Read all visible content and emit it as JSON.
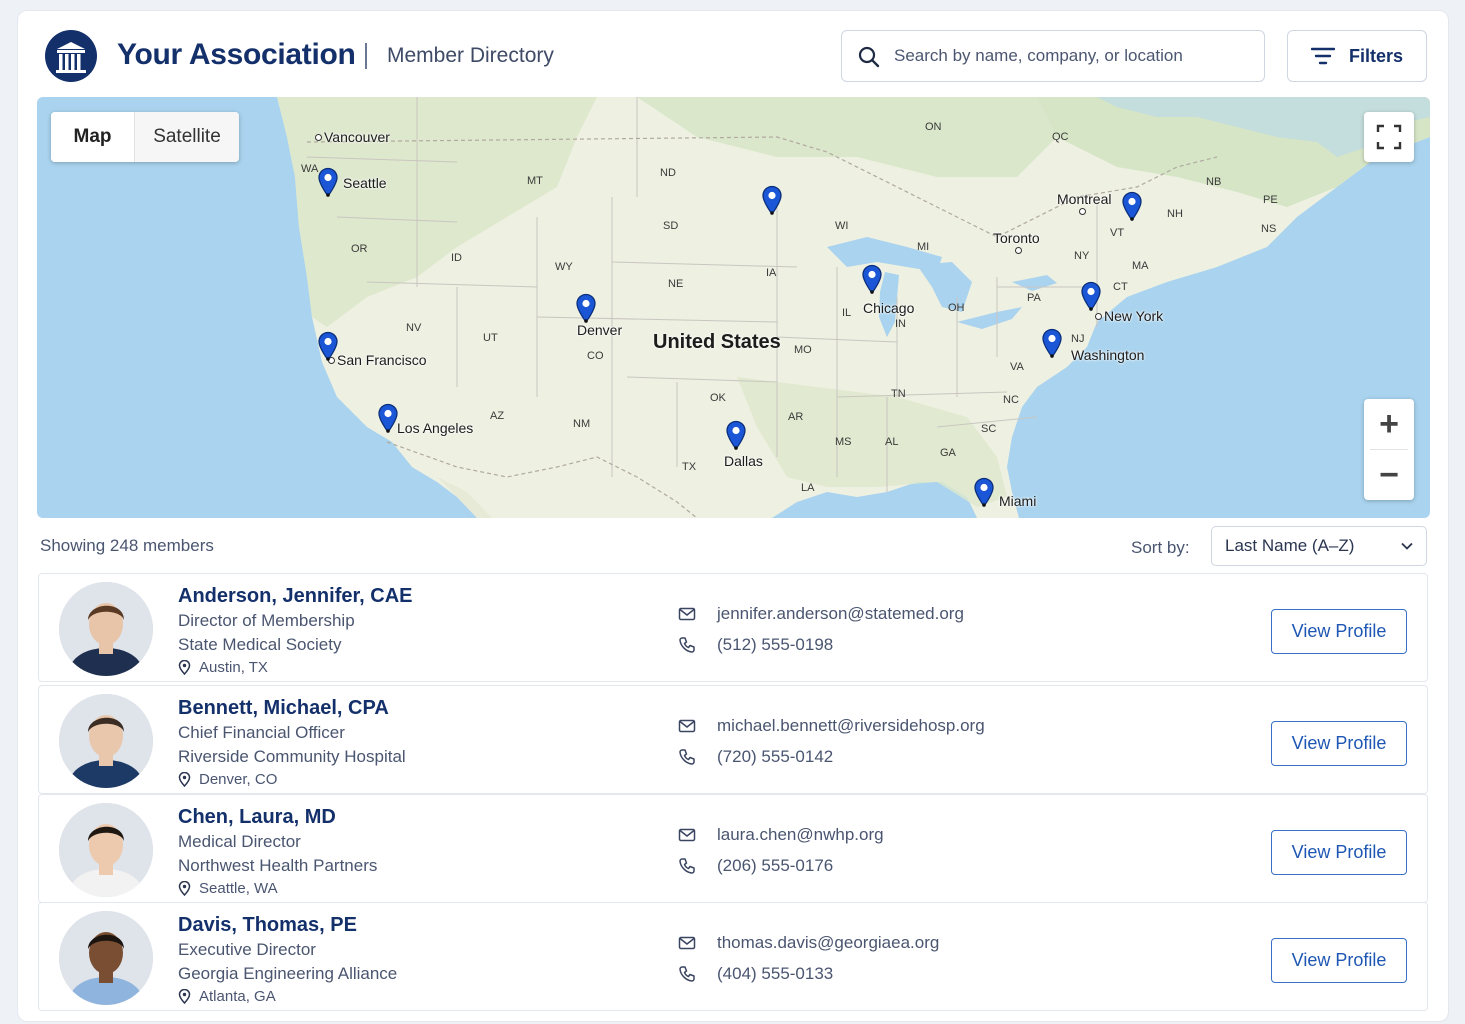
{
  "header": {
    "brand_name": "Your Association",
    "page_name": "Member Directory",
    "search_placeholder": "Search by name, company, or location",
    "filters_label": "Filters"
  },
  "map": {
    "view_toggle": {
      "active": "Map",
      "inactive": "Satellite"
    },
    "zoom_in": "+",
    "zoom_out": "−",
    "country_label": "United States",
    "state_labels": [
      "WA",
      "OR",
      "ID",
      "MT",
      "WY",
      "NV",
      "UT",
      "CO",
      "AZ",
      "NM",
      "ND",
      "SD",
      "NE",
      "IA",
      "OK",
      "TX",
      "MO",
      "AR",
      "LA",
      "MS",
      "AL",
      "TN",
      "GA",
      "SC",
      "NC",
      "VA",
      "WI",
      "MI",
      "IL",
      "IN",
      "OH",
      "PA",
      "NY",
      "VT",
      "NH",
      "MA",
      "CT",
      "NJ",
      "ON",
      "QC",
      "NB",
      "PE",
      "NS"
    ],
    "city_labels": [
      "Vancouver",
      "Seattle",
      "San Francisco",
      "Los Angeles",
      "Denver",
      "Dallas",
      "Chicago",
      "Toronto",
      "Montreal",
      "New York",
      "Washington",
      "Miami"
    ],
    "marker_cities": [
      "Seattle",
      "San Francisco",
      "Los Angeles",
      "Denver",
      "Minneapolis",
      "Dallas",
      "Chicago",
      "Montreal",
      "New York",
      "Washington",
      "Miami"
    ],
    "marker_color": "#1a56d6"
  },
  "list": {
    "showing_text": "Showing 248 members",
    "sort_label": "Sort by:",
    "sort_value": "Last Name (A–Z)"
  },
  "members": [
    {
      "name": "Anderson, Jennifer, CAE",
      "title": "Director of Membership",
      "organization": "State Medical Society",
      "location": "Austin, TX",
      "email": "jennifer.anderson@statemed.org",
      "phone": "(512) 555-0198",
      "action": "View Profile"
    },
    {
      "name": "Bennett, Michael, CPA",
      "title": "Chief Financial Officer",
      "organization": "Riverside Community Hospital",
      "location": "Denver, CO",
      "email": "michael.bennett@riversidehosp.org",
      "phone": "(720) 555-0142",
      "action": "View Profile"
    },
    {
      "name": "Chen, Laura, MD",
      "title": "Medical Director",
      "organization": "Northwest Health Partners",
      "location": "Seattle, WA",
      "email": "laura.chen@nwhp.org",
      "phone": "(206) 555-0176",
      "action": "View Profile"
    },
    {
      "name": "Davis, Thomas, PE",
      "title": "Executive Director",
      "organization": "Georgia Engineering Alliance",
      "location": "Atlanta, GA",
      "email": "thomas.davis@georgiaea.org",
      "phone": "(404) 555-0133",
      "action": "View Profile"
    }
  ],
  "colors": {
    "brand": "#14306b",
    "accent": "#1e56b3",
    "text": "#4a5570"
  }
}
